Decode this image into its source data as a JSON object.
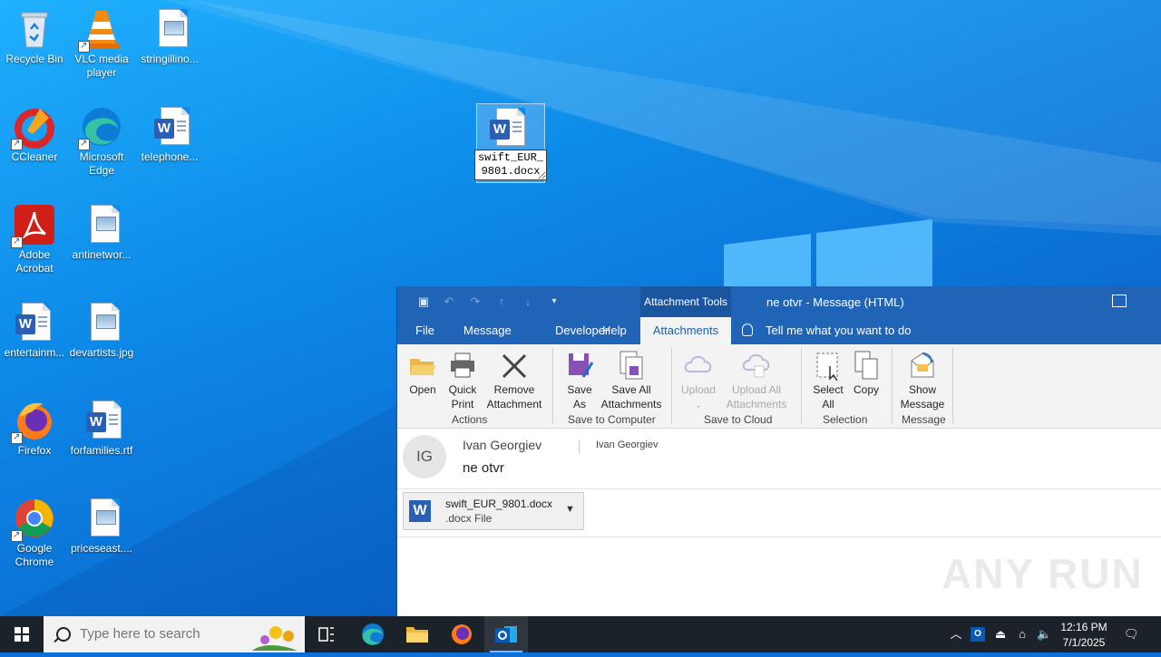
{
  "desktop": {
    "icons": [
      {
        "label": "Recycle Bin"
      },
      {
        "label": "VLC media player"
      },
      {
        "label": "stringillino..."
      },
      {
        "label": "CCleaner"
      },
      {
        "label": "Microsoft Edge"
      },
      {
        "label": "telephone..."
      },
      {
        "label": "Adobe Acrobat"
      },
      {
        "label": "antinetwor..."
      },
      {
        "label": "entertainm..."
      },
      {
        "label": "devartists.jpg"
      },
      {
        "label": "Firefox"
      },
      {
        "label": "forfamilies.rtf"
      },
      {
        "label": "Google Chrome"
      },
      {
        "label": "priceseast...."
      }
    ],
    "renaming_icon": {
      "value": "swift_EUR_9801.docx"
    }
  },
  "outlook": {
    "context_tab": "Attachment Tools",
    "title": "ne otvr  -  Message (HTML)",
    "tabs": [
      "File",
      "Message",
      "Developer",
      "Help",
      "Attachments"
    ],
    "active_tab": "Attachments",
    "tell_me": "Tell me what you want to do",
    "ribbon": {
      "open": "Open",
      "quick_print": "Quick Print",
      "remove_attachment": "Remove Attachment",
      "save_as": "Save As",
      "save_all": "Save All Attachments",
      "upload": "Upload",
      "upload_all": "Upload All Attachments",
      "select_all": "Select All",
      "copy": "Copy",
      "show_message": "Show Message",
      "groups": {
        "actions": "Actions",
        "save_to_computer": "Save to Computer",
        "save_to_cloud": "Save to Cloud",
        "selection": "Selection",
        "message": "Message"
      }
    },
    "message": {
      "avatar_initials": "IG",
      "from": "Ivan Georgiev",
      "to": "Ivan Georgiev",
      "subject": "ne otvr",
      "attachment": {
        "name": "swift_EUR_9801.docx",
        "type": ".docx File"
      }
    },
    "watermark": "ANY RUN"
  },
  "taskbar": {
    "search_placeholder": "Type here to search",
    "time": "12:16 PM",
    "date": "7/1/2025"
  },
  "colors": {
    "outlook_blue": "#2064b8",
    "taskbar": "#1c2229",
    "desktop_blue": "#0d8ae8"
  }
}
